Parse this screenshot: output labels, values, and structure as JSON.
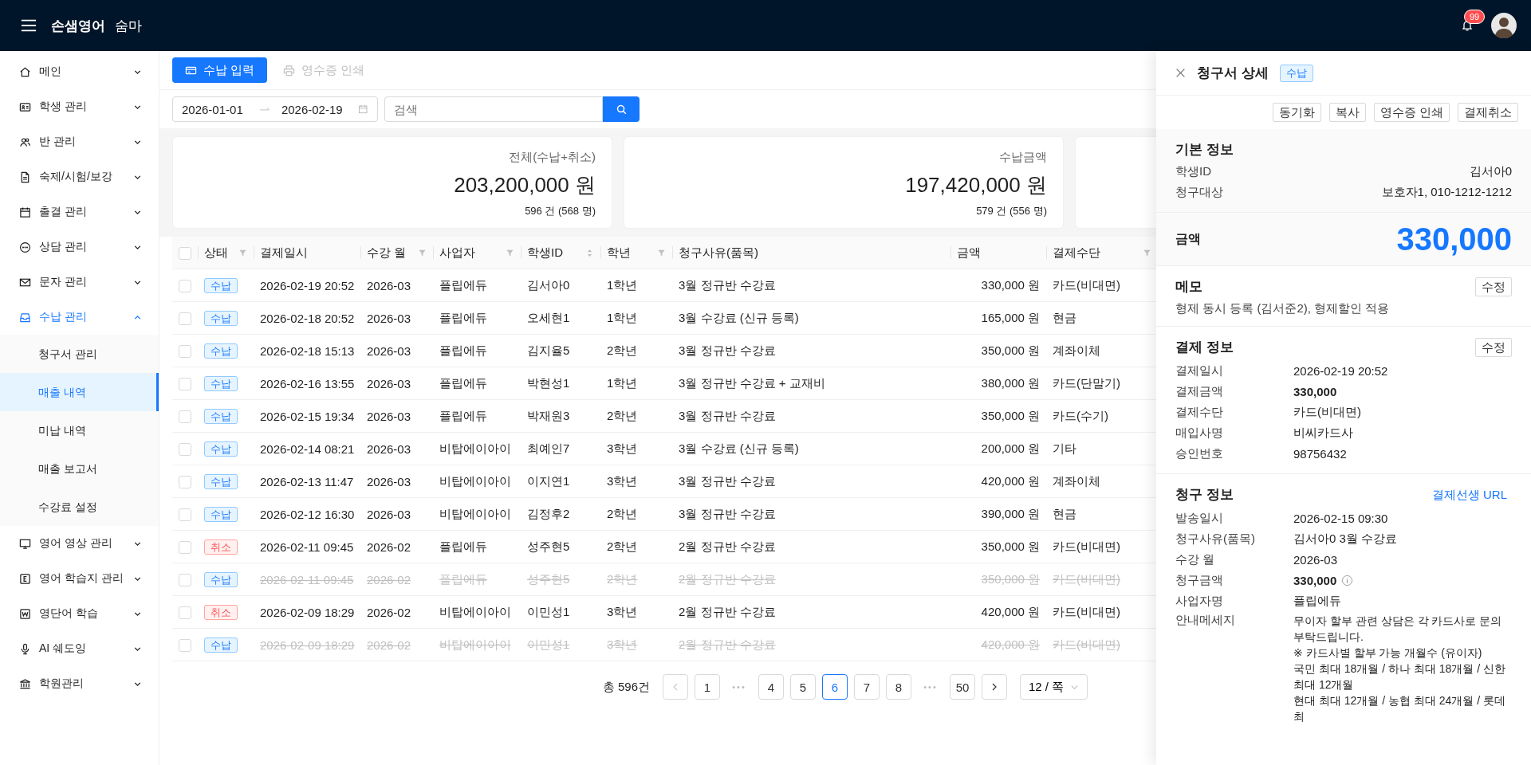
{
  "header": {
    "brand": "손샘영어",
    "subtitle": "숨마",
    "notification_count": "99"
  },
  "sidebar": {
    "items": [
      {
        "label": "메인",
        "expanded": false
      },
      {
        "label": "학생 관리",
        "expanded": false
      },
      {
        "label": "반 관리",
        "expanded": false
      },
      {
        "label": "숙제/시험/보강",
        "expanded": false
      },
      {
        "label": "출결 관리",
        "expanded": false
      },
      {
        "label": "상담 관리",
        "expanded": false
      },
      {
        "label": "문자 관리",
        "expanded": false
      },
      {
        "label": "수납 관리",
        "expanded": true,
        "children": [
          {
            "label": "청구서 관리",
            "selected": false
          },
          {
            "label": "매출 내역",
            "selected": true
          },
          {
            "label": "미납 내역",
            "selected": false
          },
          {
            "label": "매출 보고서",
            "selected": false
          },
          {
            "label": "수강료 설정",
            "selected": false
          }
        ]
      },
      {
        "label": "영어 영상 관리",
        "expanded": false
      },
      {
        "label": "영어 학습지 관리",
        "expanded": false
      },
      {
        "label": "영단어 학습",
        "expanded": false
      },
      {
        "label": "AI 쉐도잉",
        "expanded": false
      },
      {
        "label": "학원관리",
        "expanded": false
      }
    ]
  },
  "toolbar": {
    "primary_button": "수납 입력",
    "print_button": {
      "label": "영수증 인쇄",
      "disabled": true
    }
  },
  "filters": {
    "start_date": "2026-01-01",
    "end_date": "2026-02-19",
    "search": {
      "placeholder": "검색"
    }
  },
  "summary_cards": [
    {
      "label": "전체(수납+취소)",
      "amount": "203,200,000 원",
      "count": "596 건 (568 명)"
    },
    {
      "label": "수납금액",
      "amount": "197,420,000 원",
      "count": "579 건 (556 명)"
    }
  ],
  "table": {
    "select_all_checked": false,
    "columns": [
      {
        "label": "상태",
        "filter": true,
        "sort": false
      },
      {
        "label": "결제일시",
        "filter": false,
        "sort": false
      },
      {
        "label": "수강 월",
        "filter": true,
        "sort": false
      },
      {
        "label": "사업자",
        "filter": true,
        "sort": false
      },
      {
        "label": "학생ID",
        "filter": false,
        "sort": true
      },
      {
        "label": "학년",
        "filter": true,
        "sort": false
      },
      {
        "label": "청구사유(품목)",
        "filter": false,
        "sort": false
      },
      {
        "label": "금액",
        "filter": false,
        "sort": false
      },
      {
        "label": "결제수단",
        "filter": true,
        "sort": false
      }
    ],
    "rows": [
      {
        "checked": false,
        "kind": "paid",
        "voided": false,
        "cells": [
          "수납",
          "2026-02-19 20:52",
          "2026-03",
          "플립에듀",
          "김서아0",
          "1학년",
          "3월 정규반 수강료",
          "330,000 원",
          "카드(비대면)"
        ]
      },
      {
        "checked": false,
        "kind": "paid",
        "voided": false,
        "cells": [
          "수납",
          "2026-02-18 20:52",
          "2026-03",
          "플립에듀",
          "오세현1",
          "1학년",
          "3월 수강료 (신규 등록)",
          "165,000 원",
          "현금"
        ]
      },
      {
        "checked": false,
        "kind": "paid",
        "voided": false,
        "cells": [
          "수납",
          "2026-02-18 15:13",
          "2026-03",
          "플립에듀",
          "김지율5",
          "2학년",
          "3월 정규반 수강료",
          "350,000 원",
          "계좌이체"
        ]
      },
      {
        "checked": false,
        "kind": "paid",
        "voided": false,
        "cells": [
          "수납",
          "2026-02-16 13:55",
          "2026-03",
          "플립에듀",
          "박현성1",
          "1학년",
          "3월 정규반 수강료 + 교재비",
          "380,000 원",
          "카드(단말기)"
        ]
      },
      {
        "checked": false,
        "kind": "paid",
        "voided": false,
        "cells": [
          "수납",
          "2026-02-15 19:34",
          "2026-03",
          "플립에듀",
          "박재원3",
          "2학년",
          "3월 정규반 수강료",
          "350,000 원",
          "카드(수기)"
        ]
      },
      {
        "checked": false,
        "kind": "paid",
        "voided": false,
        "cells": [
          "수납",
          "2026-02-14 08:21",
          "2026-03",
          "비탑에이아이",
          "최예인7",
          "3학년",
          "3월 수강료 (신규 등록)",
          "200,000 원",
          "기타"
        ]
      },
      {
        "checked": false,
        "kind": "paid",
        "voided": false,
        "cells": [
          "수납",
          "2026-02-13 11:47",
          "2026-03",
          "비탑에이아이",
          "이지연1",
          "3학년",
          "3월 정규반 수강료",
          "420,000 원",
          "계좌이체"
        ]
      },
      {
        "checked": false,
        "kind": "paid",
        "voided": false,
        "cells": [
          "수납",
          "2026-02-12 16:30",
          "2026-03",
          "비탑에이아이",
          "김정후2",
          "2학년",
          "3월 정규반 수강료",
          "390,000 원",
          "현금"
        ]
      },
      {
        "checked": false,
        "kind": "cancelled",
        "voided": false,
        "cells": [
          "취소",
          "2026-02-11 09:45",
          "2026-02",
          "플립에듀",
          "성주현5",
          "2학년",
          "2월 정규반 수강료",
          "350,000 원",
          "카드(비대면)"
        ]
      },
      {
        "checked": false,
        "kind": "paid",
        "voided": true,
        "cells": [
          "수납",
          "2026-02-11 09:45",
          "2026-02",
          "플립에듀",
          "성주현5",
          "2학년",
          "2월 정규반 수강료",
          "350,000 원",
          "카드(비대면)"
        ]
      },
      {
        "checked": false,
        "kind": "cancelled",
        "voided": false,
        "cells": [
          "취소",
          "2026-02-09 18:29",
          "2026-02",
          "비탑에이아이",
          "이민성1",
          "3학년",
          "2월 정규반 수강료",
          "420,000 원",
          "카드(비대면)"
        ]
      },
      {
        "checked": false,
        "kind": "paid",
        "voided": true,
        "cells": [
          "수납",
          "2026-02-09 18:29",
          "2026-02",
          "비탑에이아이",
          "이민성1",
          "3학년",
          "2월 정규반 수강료",
          "420,000 원",
          "카드(비대면)"
        ]
      }
    ]
  },
  "pagination": {
    "total": "총 596건",
    "prev": {
      "disabled": true
    },
    "next": {
      "disabled": false
    },
    "items": [
      {
        "kind": "page",
        "label": "1",
        "selected": false
      },
      {
        "kind": "ellipsis",
        "label": "•••"
      },
      {
        "kind": "page",
        "label": "4",
        "selected": false
      },
      {
        "kind": "page",
        "label": "5",
        "selected": false
      },
      {
        "kind": "page",
        "label": "6",
        "selected": true
      },
      {
        "kind": "page",
        "label": "7",
        "selected": false
      },
      {
        "kind": "page",
        "label": "8",
        "selected": false
      },
      {
        "kind": "ellipsis",
        "label": "•••"
      },
      {
        "kind": "page",
        "label": "50",
        "selected": false
      }
    ],
    "page_size": "12 / 쪽"
  },
  "drawer": {
    "title": "청구서 상세",
    "status_tag": "수납",
    "actions": [
      "동기화",
      "복사",
      "영수증 인쇄",
      "결제취소"
    ],
    "basic_info": {
      "title": "기본 정보",
      "rows": [
        {
          "label": "학생ID",
          "value": "김서아0"
        },
        {
          "label": "청구대상",
          "value": "보호자1, 010-1212-1212"
        }
      ]
    },
    "amount": {
      "label": "금액",
      "value": "330,000"
    },
    "memo": {
      "title": "메모",
      "edit_button": "수정",
      "text": "형제 동시 등록 (김서준2), 형제할인 적용"
    },
    "payment_info": {
      "title": "결제 정보",
      "edit_button": "수정",
      "rows": [
        {
          "label": "결제일시",
          "value": "2026-02-19 20:52",
          "bold": false
        },
        {
          "label": "결제금액",
          "value": "330,000",
          "bold": true
        },
        {
          "label": "결제수단",
          "value": "카드(비대면)",
          "bold": false
        },
        {
          "label": "매입사명",
          "value": "비씨카드사",
          "bold": false
        },
        {
          "label": "승인번호",
          "value": "98756432",
          "bold": false
        }
      ]
    },
    "billing_info": {
      "title": "청구 정보",
      "link": "결제선생 URL",
      "rows": [
        {
          "label": "발송일시",
          "value": "2026-02-15 09:30",
          "bold": false
        },
        {
          "label": "청구사유(품목)",
          "value": "김서아0 3월 수강료",
          "bold": false
        },
        {
          "label": "수강 월",
          "value": "2026-03",
          "bold": false
        },
        {
          "label": "청구금액",
          "value": "330,000",
          "bold": true,
          "info_icon": true
        },
        {
          "label": "사업자명",
          "value": "플립에듀",
          "bold": false
        }
      ],
      "notice": {
        "label": "안내메세지",
        "lines": [
          "무이자 할부 관련 상담은 각 카드사로 문의 부탁드립니다.",
          "※ 카드사별 할부 가능 개월수 (유이자)",
          "국민 최대 18개월 / 하나 최대 18개월 / 신한 최대 12개월",
          "현대 최대 12개월 / 농협 최대 24개월 / 롯데 최"
        ]
      }
    }
  }
}
